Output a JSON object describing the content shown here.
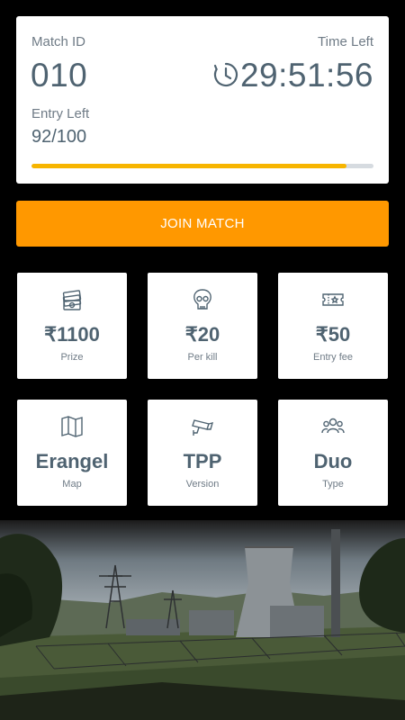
{
  "match": {
    "id_label": "Match ID",
    "id_value": "010",
    "time_label": "Time Left",
    "time_value": "29:51:56",
    "entry_label": "Entry Left",
    "entry_value": "92/100",
    "entry_progress": 0.92
  },
  "join_button": "JOIN MATCH",
  "stats": [
    {
      "icon": "money-stack-icon",
      "value": "₹1100",
      "caption": "Prize"
    },
    {
      "icon": "skull-icon",
      "value": "₹20",
      "caption": "Per kill"
    },
    {
      "icon": "ticket-icon",
      "value": "₹50",
      "caption": "Entry fee"
    },
    {
      "icon": "map-icon",
      "value": "Erangel",
      "caption": "Map"
    },
    {
      "icon": "camera-icon",
      "value": "TPP",
      "caption": "Version"
    },
    {
      "icon": "group-icon",
      "value": "Duo",
      "caption": "Type"
    }
  ],
  "colors": {
    "accent": "#ff9800",
    "progress": "#f7b500",
    "text": "#4f6371"
  }
}
